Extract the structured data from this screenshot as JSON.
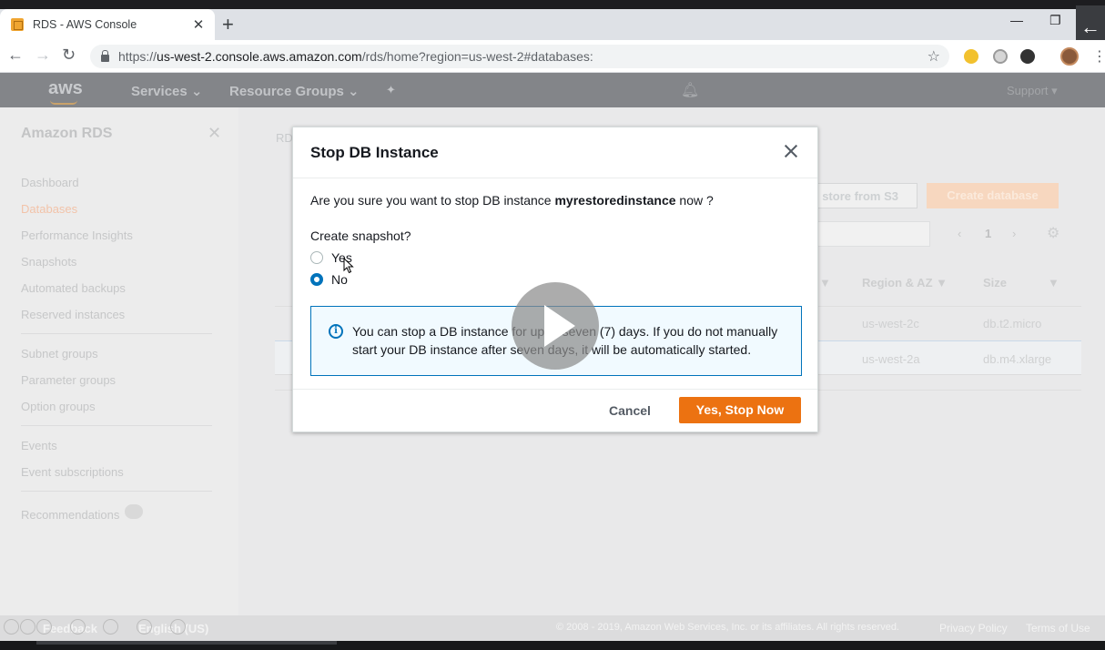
{
  "browser": {
    "tab_title": "RDS - AWS Console",
    "tab_close": "✕",
    "new_tab": "+",
    "url_host": "us-west-2.console.aws.amazon.com",
    "url_prefix": "https://",
    "url_path": "/rds/home?region=us-west-2#databases:",
    "window_minimize": "—",
    "window_restore": "❐",
    "back_overlay": "←"
  },
  "aws_nav": {
    "logo": "aws",
    "services": "Services ⌄",
    "resource_groups": "Resource Groups ⌄",
    "support": "Support ▾"
  },
  "sidebar": {
    "title": "Amazon RDS",
    "items": [
      {
        "label": "Dashboard"
      },
      {
        "label": "Databases"
      },
      {
        "label": "Performance Insights"
      },
      {
        "label": "Snapshots"
      },
      {
        "label": "Automated backups"
      },
      {
        "label": "Reserved instances"
      },
      {
        "label": "Subnet groups"
      },
      {
        "label": "Parameter groups"
      },
      {
        "label": "Option groups"
      },
      {
        "label": "Events"
      },
      {
        "label": "Event subscriptions"
      },
      {
        "label": "Recommendations"
      }
    ],
    "recommendations_badge": "1"
  },
  "content": {
    "breadcrumb": "RD",
    "restore_button": "store from S3",
    "create_button": "Create database",
    "pager_prev": "‹",
    "page_number": "1",
    "pager_next": "›",
    "columns": [
      "Region & AZ",
      "Size"
    ],
    "rows": [
      {
        "region": "us-west-2c",
        "size": "db.t2.micro"
      },
      {
        "region": "us-west-2a",
        "size": "db.m4.xlarge"
      }
    ]
  },
  "modal": {
    "title": "Stop DB Instance",
    "question_prefix": "Are you sure you want to stop DB instance ",
    "instance_name": "myrestoredinstance",
    "question_suffix": " now ?",
    "snapshot_label": "Create snapshot?",
    "option_yes": "Yes",
    "option_no": "No",
    "selected_option": "No",
    "info_text": "You can stop a DB instance for up to seven (7) days. If you do not manually start your DB instance after seven days, it will be automatically started.",
    "cancel_label": "Cancel",
    "confirm_label": "Yes, Stop Now"
  },
  "footer": {
    "feedback": "Feedback",
    "language": "English (US)",
    "copyright": "© 2008 - 2019, Amazon Web Services, Inc. or its affiliates. All rights reserved.",
    "privacy": "Privacy Policy",
    "terms": "Terms of Use"
  },
  "colors": {
    "accent_orange": "#ec7211",
    "info_blue": "#0073bb"
  }
}
